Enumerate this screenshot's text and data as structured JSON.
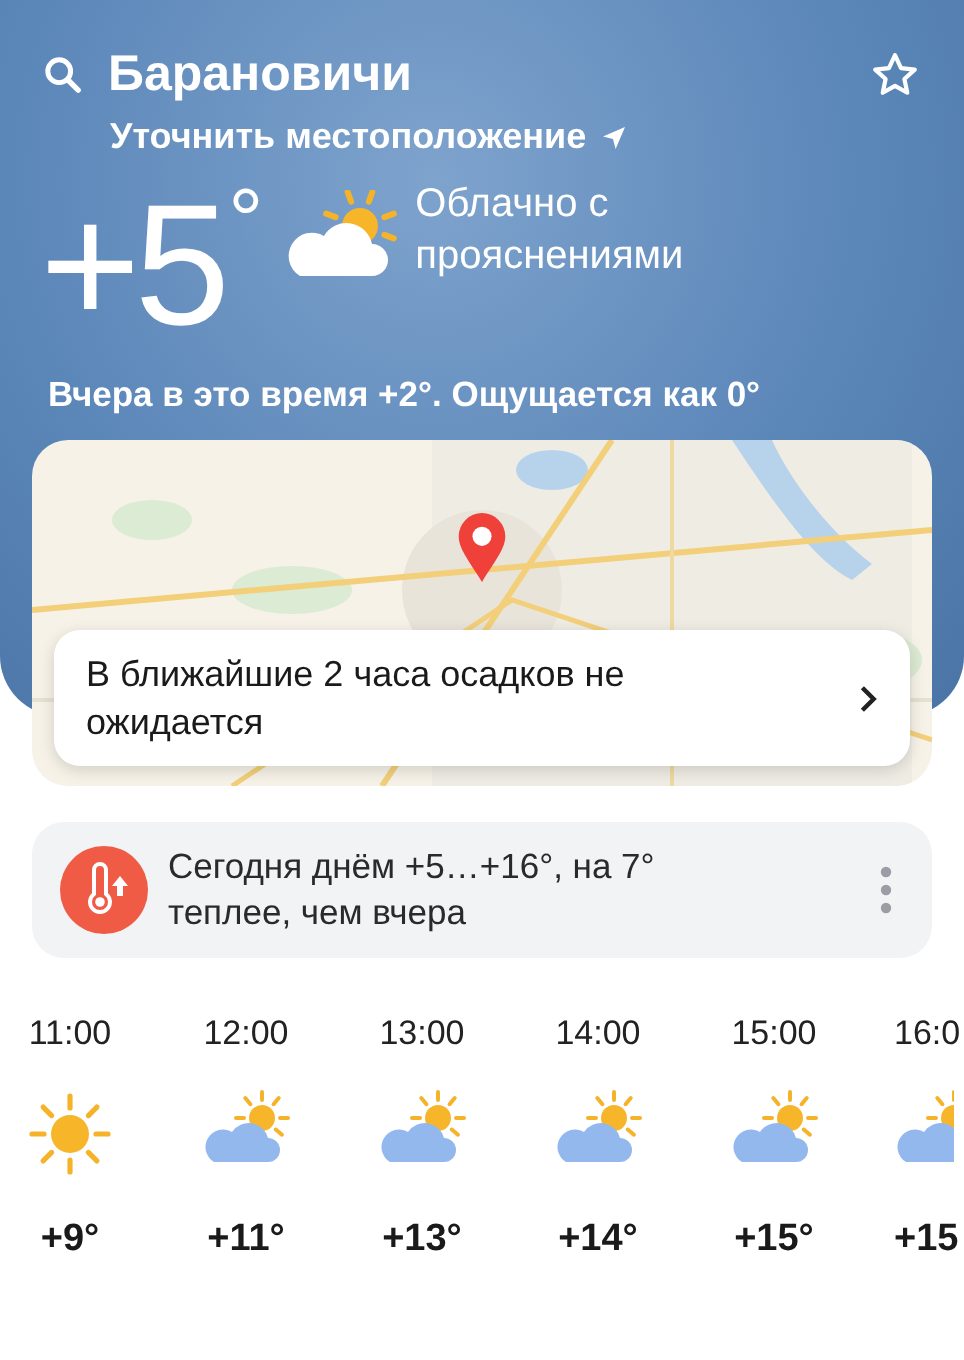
{
  "header": {
    "city": "Барановичи",
    "favorite": false,
    "locate_link": "Уточнить местоположение"
  },
  "current": {
    "temperature": "+5",
    "unit": "°",
    "condition": "Облачно с прояснениями",
    "kind": "partly_cloudy",
    "yesterday": "Вчера в это время +2°. Ощущается как 0°"
  },
  "map": {
    "kind": "picture",
    "nowcast": "В ближайшие 2 часа осадков не ожидается"
  },
  "alert": {
    "text": "Сегодня днём +5…+16°, на 7° теплее, чем вчера"
  },
  "hours": [
    {
      "time": "11:00",
      "kind": "sunny",
      "temp": "+9°"
    },
    {
      "time": "12:00",
      "kind": "partly_cloudy",
      "temp": "+11°"
    },
    {
      "time": "13:00",
      "kind": "partly_cloudy",
      "temp": "+13°"
    },
    {
      "time": "14:00",
      "kind": "partly_cloudy",
      "temp": "+14°"
    },
    {
      "time": "15:00",
      "kind": "partly_cloudy",
      "temp": "+15°"
    },
    {
      "time": "16:0",
      "kind": "partly_cloudy",
      "temp": "+15"
    }
  ]
}
